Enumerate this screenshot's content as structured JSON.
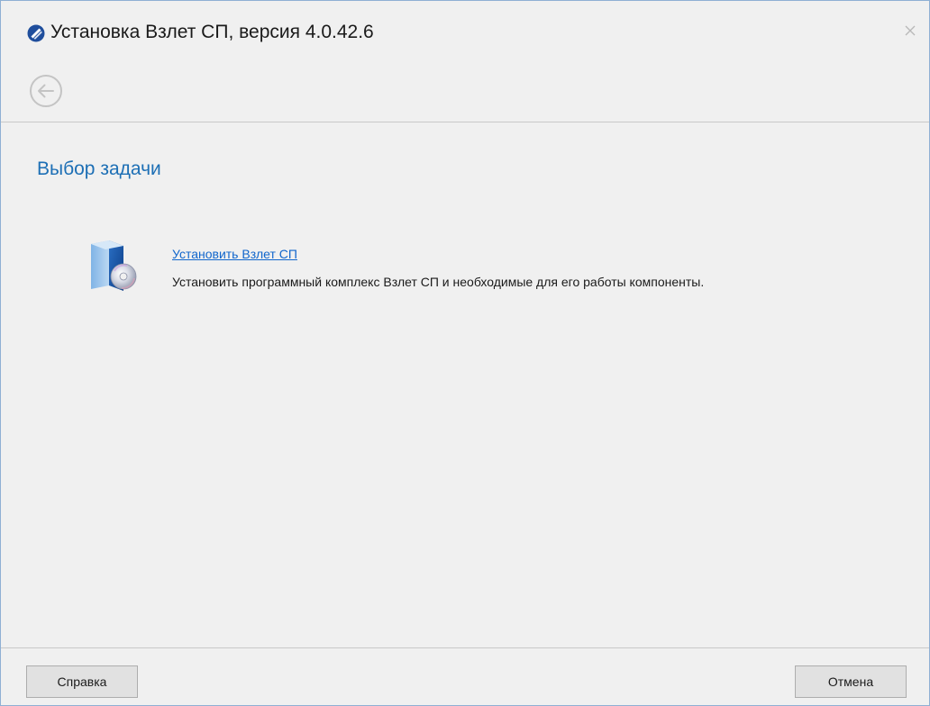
{
  "window": {
    "title": "Установка Взлет СП, версия 4.0.42.6"
  },
  "page": {
    "title": "Выбор задачи"
  },
  "task": {
    "link_label": "Установить Взлет СП",
    "description": "Установить программный комплекс Взлет СП и необходимые для его работы компоненты."
  },
  "footer": {
    "help_label": "Справка",
    "cancel_label": "Отмена"
  },
  "icons": {
    "app": "app-logo-icon",
    "close": "close-icon",
    "back": "back-arrow-icon",
    "task": "software-box-icon"
  },
  "colors": {
    "accent_title": "#1d6fb5",
    "link": "#1166cc"
  }
}
